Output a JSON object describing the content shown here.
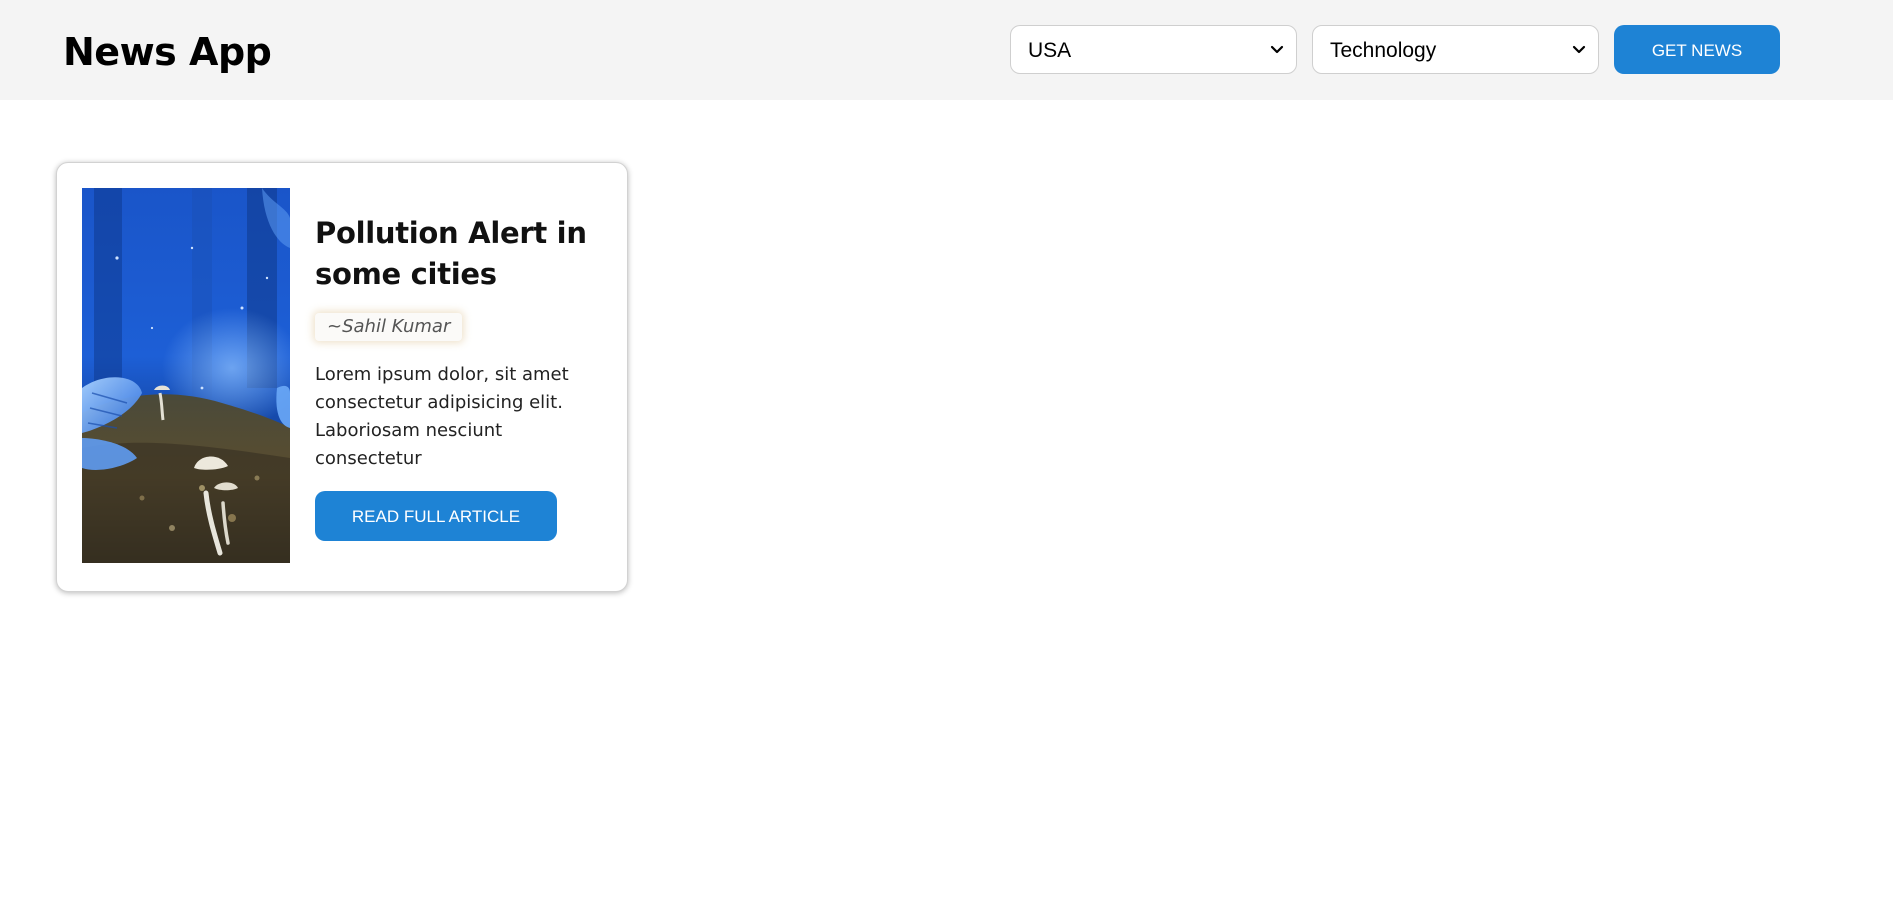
{
  "header": {
    "title": "News App",
    "country_select": {
      "value": "USA",
      "icon": "chevron-down-icon"
    },
    "category_select": {
      "value": "Technology",
      "icon": "chevron-down-icon"
    },
    "get_news_label": "GET NEWS"
  },
  "articles": [
    {
      "title": "Pollution Alert in some cities",
      "author": "~Sahil Kumar",
      "description": "Lorem ipsum dolor, sit amet consectetur adipisicing elit. Laboriosam nesciunt consectetur",
      "read_more_label": "READ FULL ARTICLE"
    }
  ],
  "colors": {
    "header_bg": "#f4f4f4",
    "accent": "#1e83d5",
    "button_text": "#ffffff"
  }
}
